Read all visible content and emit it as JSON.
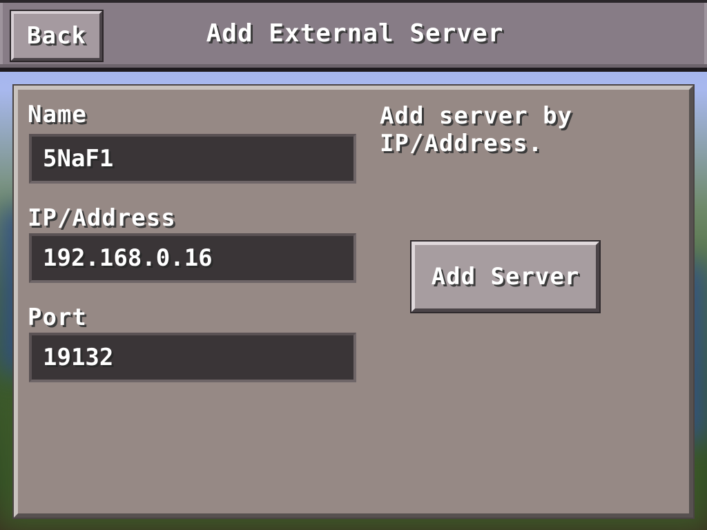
{
  "header": {
    "back_label": "Back",
    "title": "Add External Server"
  },
  "form": {
    "name_label": "Name",
    "name_value": "5NaF1",
    "address_label": "IP/Address",
    "address_value": "192.168.0.16",
    "port_label": "Port",
    "port_value": "19132"
  },
  "side": {
    "hint": "Add server by IP/Address.",
    "add_button_label": "Add Server"
  },
  "colors": {
    "header_bg": "#877c86",
    "panel_bg": "#968985",
    "field_bg": "#3a3537",
    "sky": "#a8b8ee"
  }
}
